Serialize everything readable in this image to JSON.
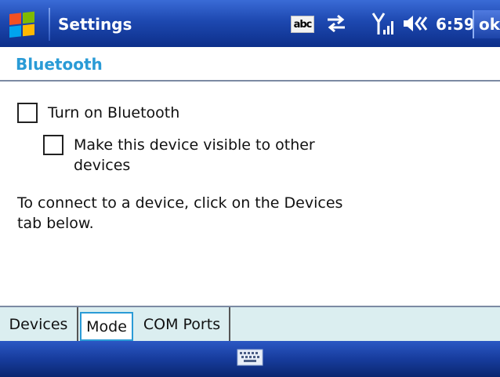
{
  "titlebar": {
    "app_title": "Settings",
    "start_icon": "windows-flag-icon",
    "input_mode": "abc",
    "sync_icon": "connectivity-arrows-icon",
    "signal_icon": "signal-strength-icon",
    "volume_icon": "speaker-icon",
    "time": "6:59",
    "ok_label": "ok"
  },
  "page": {
    "title": "Bluetooth"
  },
  "options": {
    "turn_on_label": "Turn on Bluetooth",
    "turn_on_checked": false,
    "visible_label_line1": "Make this device visible to other",
    "visible_label_line2": "devices",
    "visible_checked": false
  },
  "info": {
    "line1": "To connect to a device, click on the Devices",
    "line2": "tab below."
  },
  "tabs": [
    {
      "label": "Devices",
      "active": false
    },
    {
      "label": "Mode",
      "active": true
    },
    {
      "label": "COM Ports",
      "active": false
    }
  ],
  "bottombar": {
    "keyboard_icon": "keyboard-icon"
  },
  "colors": {
    "accent": "#2a9bd6",
    "titlebar": "#1d48b0",
    "tabbar_bg": "#dbeef0"
  }
}
